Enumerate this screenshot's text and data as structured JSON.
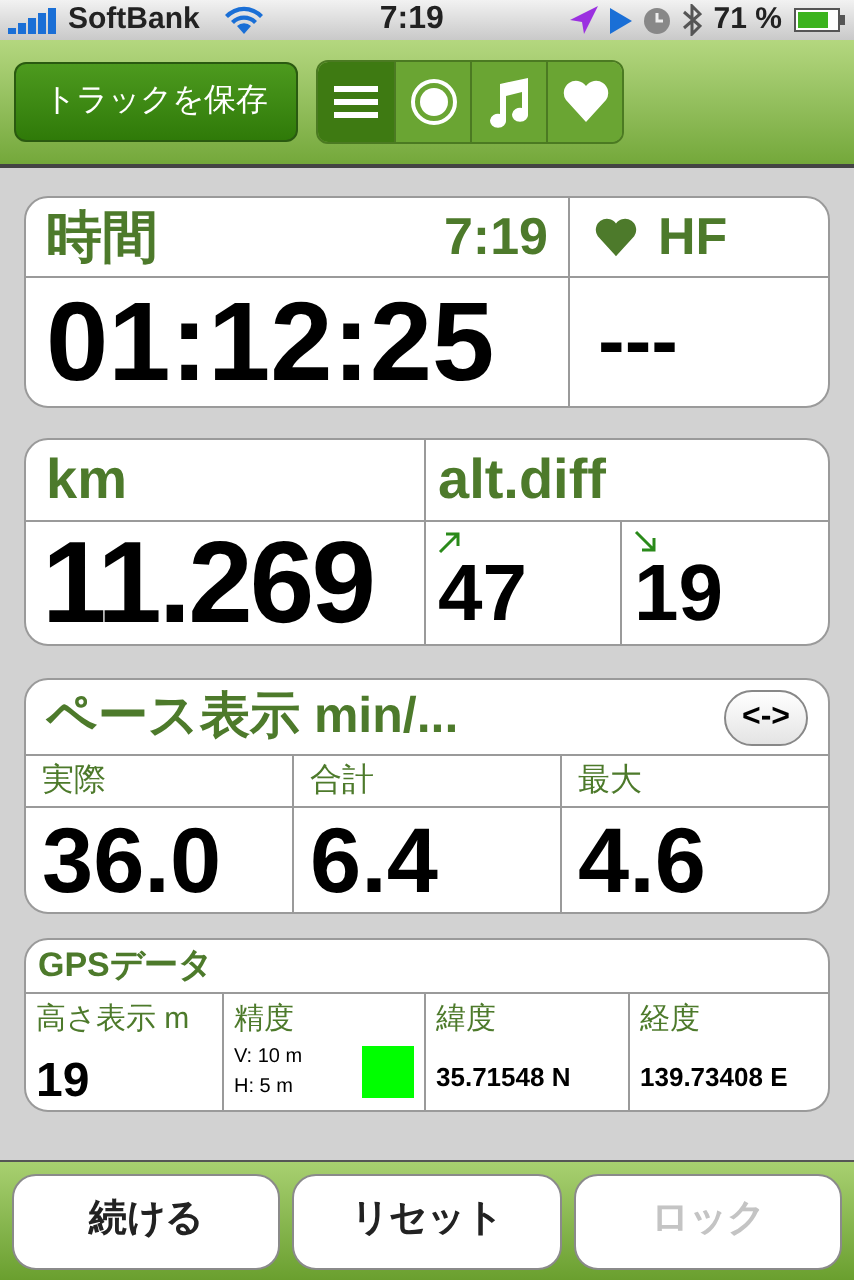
{
  "status_bar": {
    "carrier": "SoftBank",
    "time": "7:19",
    "battery": "71 %"
  },
  "toolbar": {
    "save_button": "トラックを保存",
    "views": [
      {
        "kind": "list",
        "selected": true
      },
      {
        "kind": "record",
        "selected": false
      },
      {
        "kind": "music",
        "selected": false
      },
      {
        "kind": "heart",
        "selected": false
      }
    ]
  },
  "time_panel": {
    "title": "時間",
    "clock": "7:19",
    "elapsed": "01:12:25",
    "heart_rate_title": "HF",
    "heart_rate": "---"
  },
  "distance_panel": {
    "title": "km",
    "distance": "11.269",
    "alt_title": "alt.diff",
    "ascent": "47",
    "descent": "19"
  },
  "pace_panel": {
    "title": "ペース表示 min/...",
    "toggle": "<->",
    "cells": [
      {
        "label": "実際",
        "value": "36.0"
      },
      {
        "label": "合計",
        "value": "6.4"
      },
      {
        "label": "最大",
        "value": "4.6"
      }
    ]
  },
  "gps_panel": {
    "title": "GPSデータ",
    "altitude_label": "高さ表示 m",
    "altitude": "19",
    "accuracy_label": "精度",
    "vertical": "V: 10 m",
    "horizontal": "H: 5 m",
    "accuracy_indicator": {
      "color": "#00ff00"
    },
    "latitude_label": "緯度",
    "latitude": "35.71548 N",
    "longitude_label": "経度",
    "longitude": "139.73408 E"
  },
  "buttons": [
    {
      "label": "続ける",
      "disabled": false
    },
    {
      "label": "リセット",
      "disabled": false
    },
    {
      "label": "ロック",
      "disabled": true
    }
  ]
}
